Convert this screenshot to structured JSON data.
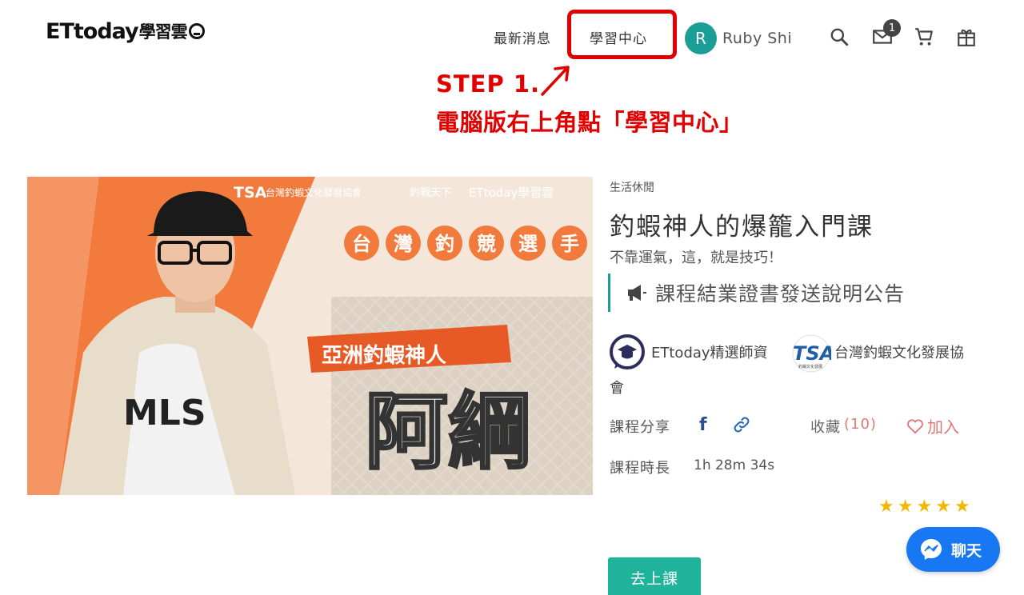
{
  "header": {
    "logo_et": "ETtoday",
    "logo_cn": "學習雲",
    "nav": {
      "news": "最新消息",
      "learning_center": "學習中心"
    },
    "user": {
      "initial": "R",
      "name": "Ruby Shi"
    },
    "mail_badge": "1"
  },
  "annotation": {
    "step": "STEP 1.",
    "description": "電腦版右上角點「學習中心」"
  },
  "banner": {
    "sponsor_tsa": "TSA",
    "sponsor_tsa_name": "台灣釣蝦文化發展協會",
    "sponsor_mid": "釣戰天下",
    "sponsor_logo": "ETtoday學習雲",
    "tags": [
      "台",
      "灣",
      "釣",
      "競",
      "選",
      "手"
    ],
    "ribbon": "亞洲釣蝦神人",
    "big_name": "阿綱",
    "shirt_text": "MLS"
  },
  "course": {
    "category": "生活休閒",
    "title": "釣蝦神人的爆籠入門課",
    "subtitle": "不靠運氣，這，就是技巧！",
    "notice": "課程結業證書發送說明公告",
    "teacher1": "ETtoday精選師資",
    "teacher2_line1": "台灣釣蝦文化發展協",
    "teacher2_line2": "會",
    "teacher2_badge": "TSA",
    "teacher2_badge_sub": "釣蝦文化發展",
    "share_label": "課程分享",
    "fb": "f",
    "fav_label": "收藏",
    "fav_count": "(10)",
    "add_fav": "加入",
    "duration_label": "課程時長",
    "duration_value": "1h 28m 34s",
    "stars": [
      "★",
      "★",
      "★",
      "★",
      "★"
    ],
    "go_button": "去上課"
  },
  "chat": {
    "label": "聊天"
  },
  "colors": {
    "accent": "#1a9e96",
    "annotation": "#e00000",
    "cta": "#20b39b",
    "messenger": "#1877f2"
  }
}
